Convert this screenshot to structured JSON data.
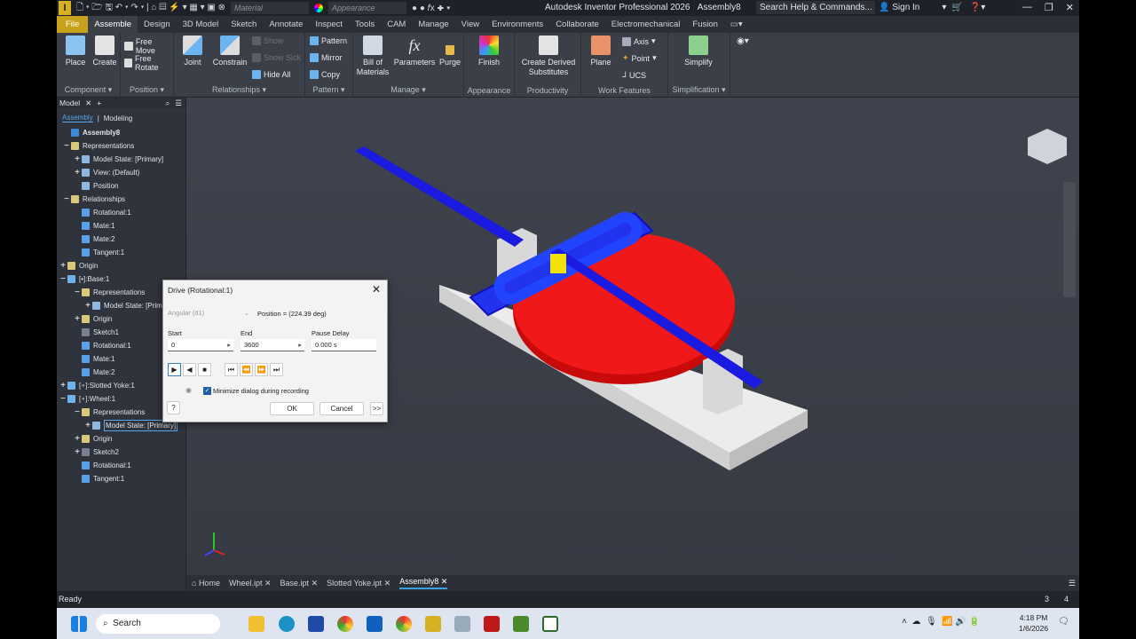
{
  "titlebar": {
    "title": "Autodesk Inventor Professional 2026",
    "document": "Assembly8",
    "material_placeholder": "Material",
    "appearance_placeholder": "Appearance",
    "search": "Search Help & Commands...",
    "sign_in": "Sign In"
  },
  "ribbon_tabs": [
    "File",
    "Assemble",
    "Design",
    "3D Model",
    "Sketch",
    "Annotate",
    "Inspect",
    "Tools",
    "CAM",
    "Manage",
    "View",
    "Environments",
    "Collaborate",
    "Electromechanical",
    "Fusion"
  ],
  "ribbon": {
    "component": {
      "label": "Component",
      "place": "Place",
      "create": "Create"
    },
    "position": {
      "label": "Position",
      "free_move": "Free Move",
      "free_rotate": "Free Rotate"
    },
    "relationships": {
      "label": "Relationships",
      "joint": "Joint",
      "constrain": "Constrain",
      "show": "Show",
      "show_sick": "Show Sick",
      "hide_all": "Hide All"
    },
    "pattern": {
      "label": "Pattern",
      "pattern": "Pattern",
      "mirror": "Mirror",
      "copy": "Copy"
    },
    "manage": {
      "label": "Manage",
      "bom1": "Bill of",
      "bom2": "Materials",
      "parameters": "Parameters",
      "purge": "Purge"
    },
    "appearance": {
      "label": "Appearance",
      "finish": "Finish"
    },
    "productivity": {
      "label": "Productivity",
      "cds1": "Create Derived",
      "cds2": "Substitutes"
    },
    "work_features": {
      "label": "Work Features",
      "plane": "Plane",
      "axis": "Axis",
      "point": "Point",
      "ucs": "UCS"
    },
    "simplification": {
      "label": "Simplification",
      "simplify": "Simplify"
    }
  },
  "browser": {
    "tab": "Model",
    "modes": [
      "Assembly",
      "Modeling"
    ],
    "tree": [
      {
        "t": "",
        "l": "Assembly8",
        "d": 0,
        "c": "#3a8ad8"
      },
      {
        "t": "−",
        "l": "Representations",
        "d": 0,
        "c": "#d9c77a"
      },
      {
        "t": "+",
        "l": "Model State: [Primary]",
        "d": 1,
        "c": "#8fb8e0"
      },
      {
        "t": "+",
        "l": "View: (Default)",
        "d": 1,
        "c": "#8fb8e0"
      },
      {
        "t": "",
        "l": "Position",
        "d": 1,
        "c": "#8fb8e0"
      },
      {
        "t": "−",
        "l": "Relationships",
        "d": 0,
        "c": "#d9c77a"
      },
      {
        "t": "",
        "l": "Rotational:1",
        "d": 1,
        "c": "#5aa0e8"
      },
      {
        "t": "",
        "l": "Mate:1",
        "d": 1,
        "c": "#5aa0e8"
      },
      {
        "t": "",
        "l": "Mate:2",
        "d": 1,
        "c": "#5aa0e8"
      },
      {
        "t": "",
        "l": "Tangent:1",
        "d": 1,
        "c": "#5aa0e8"
      },
      {
        "t": "+",
        "l": "Origin",
        "d": -1,
        "c": "#d9c77a"
      },
      {
        "t": "−",
        "l": "[•]:Base:1",
        "d": -1,
        "c": "#6fb4e8"
      },
      {
        "t": "−",
        "l": "Representations",
        "d": 0,
        "c": "#d9c77a"
      },
      {
        "t": "+",
        "l": "Model State: [Prima",
        "d": 1,
        "c": "#8fb8e0"
      },
      {
        "t": "+",
        "l": "Origin",
        "d": 0,
        "c": "#d9c77a"
      },
      {
        "t": "",
        "l": "Sketch1",
        "d": 0,
        "c": "#7a8090"
      },
      {
        "t": "",
        "l": "Rotational:1",
        "d": 0,
        "c": "#5aa0e8"
      },
      {
        "t": "",
        "l": "Mate:1",
        "d": 0,
        "c": "#5aa0e8"
      },
      {
        "t": "",
        "l": "Mate:2",
        "d": 0,
        "c": "#5aa0e8"
      },
      {
        "t": "+",
        "l": "[∘]:Slotted Yoke:1",
        "d": -1,
        "c": "#6fb4e8"
      },
      {
        "t": "−",
        "l": "[∘]:Wheel:1",
        "d": -1,
        "c": "#6fb4e8"
      },
      {
        "t": "−",
        "l": "Representations",
        "d": 0,
        "c": "#d9c77a"
      },
      {
        "t": "+",
        "l": "Model State: [Primary]",
        "d": 1,
        "c": "#8fb8e0"
      },
      {
        "t": "+",
        "l": "Origin",
        "d": 0,
        "c": "#d9c77a"
      },
      {
        "t": "+",
        "l": "Sketch2",
        "d": 0,
        "c": "#7a8090"
      },
      {
        "t": "",
        "l": "Rotational:1",
        "d": 0,
        "c": "#5aa0e8"
      },
      {
        "t": "",
        "l": "Tangent:1",
        "d": 0,
        "c": "#5aa0e8"
      }
    ]
  },
  "dialog": {
    "title": "Drive (Rotational:1)",
    "type": "Angular (d1)",
    "position": "Position = (224.39 deg)",
    "start_label": "Start",
    "start": "0",
    "end_label": "End",
    "end": "3600",
    "pause_label": "Pause Delay",
    "pause": "0.000 s",
    "minimize": "Minimize dialog during recording",
    "minimize_checked": true,
    "ok": "OK",
    "cancel": "Cancel",
    "more": ">>"
  },
  "doc_tabs": [
    "Home",
    "Wheel.ipt",
    "Base.ipt",
    "Slotted Yoke.ipt",
    "Assembly8"
  ],
  "status": {
    "text": "Ready",
    "n1": "3",
    "n2": "4"
  },
  "taskbar": {
    "search": "Search",
    "time": "4:18 PM",
    "date": "1/6/2026"
  }
}
